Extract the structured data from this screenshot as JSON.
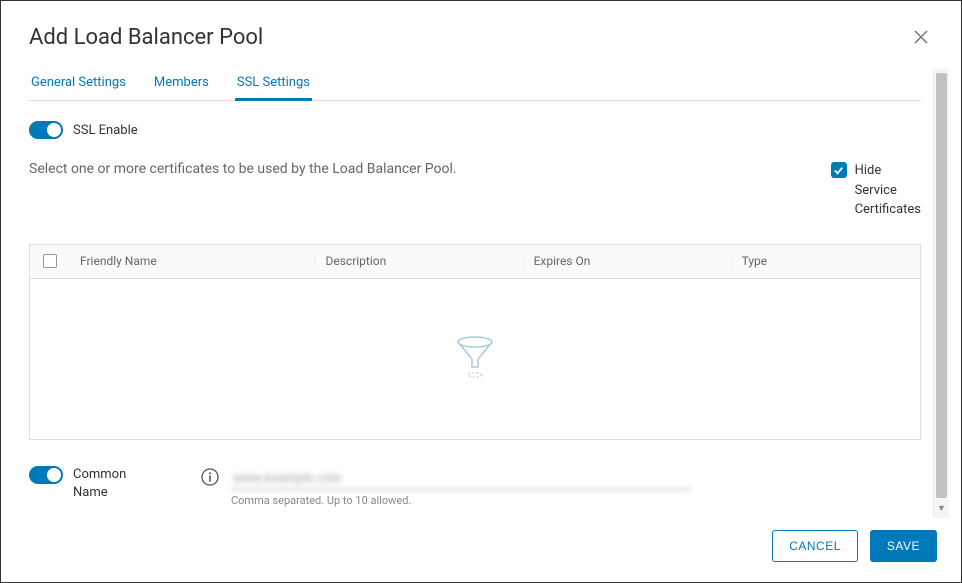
{
  "header": {
    "title": "Add Load Balancer Pool"
  },
  "tabs": [
    {
      "label": "General Settings"
    },
    {
      "label": "Members"
    },
    {
      "label": "SSL Settings"
    }
  ],
  "ssl_enable": {
    "label": "SSL Enable"
  },
  "cert_section": {
    "description": "Select one or more certificates to be used by the Load Balancer Pool.",
    "hide_label": "Hide Service Certificates"
  },
  "table": {
    "columns": {
      "friendly_name": "Friendly Name",
      "description": "Description",
      "expires_on": "Expires On",
      "type": "Type"
    }
  },
  "common_name": {
    "label": "Common Name",
    "value": "www.example.com",
    "helper": "Comma separated. Up to 10 allowed."
  },
  "footer": {
    "cancel": "CANCEL",
    "save": "SAVE"
  }
}
